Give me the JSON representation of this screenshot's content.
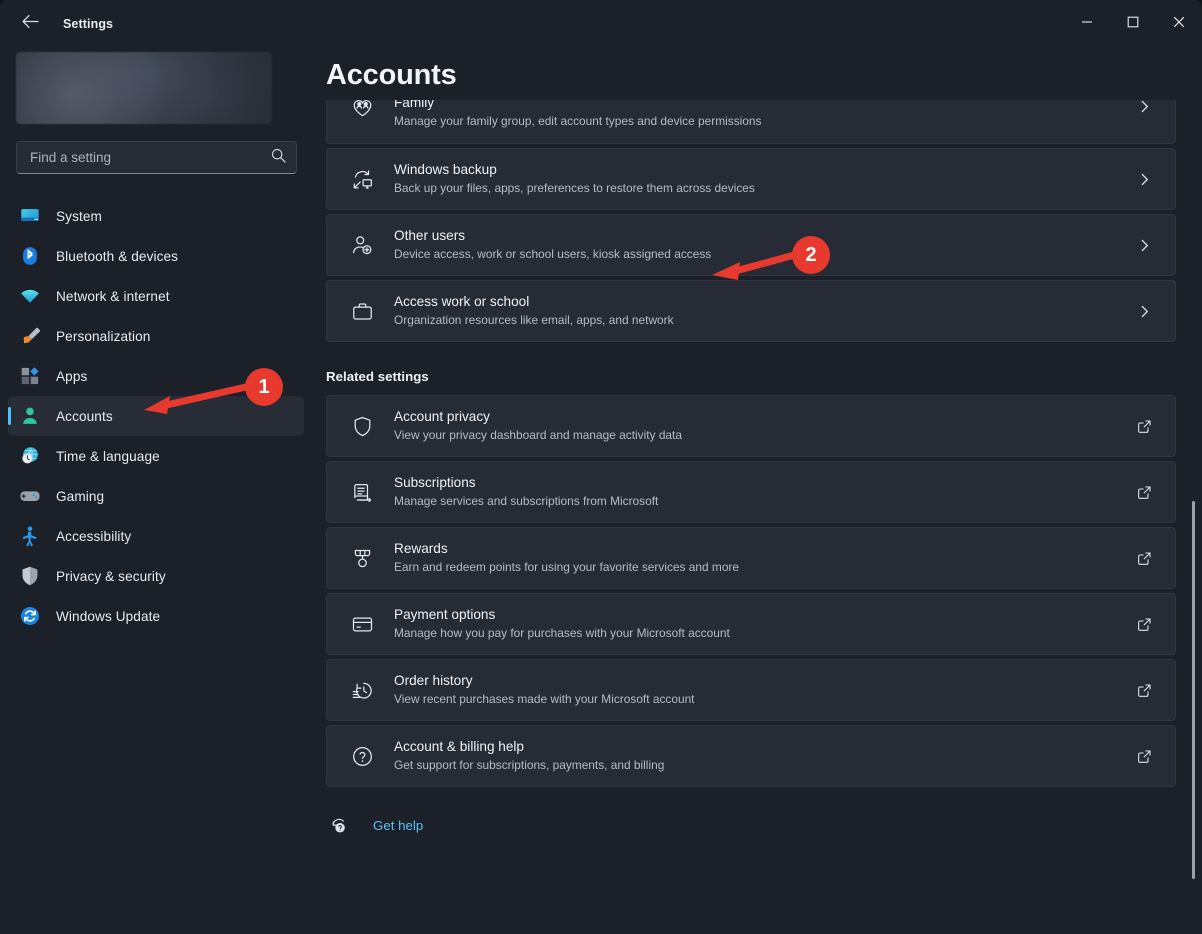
{
  "window": {
    "app_title": "Settings",
    "back_icon": "back-arrow-icon",
    "minimize_label": "Minimize",
    "maximize_label": "Maximize",
    "close_label": "Close"
  },
  "sidebar": {
    "profile": {
      "blurred": true,
      "name": ""
    },
    "search": {
      "placeholder": "Find a setting",
      "value": "",
      "icon": "search-icon"
    },
    "items": [
      {
        "label": "System",
        "icon": "monitor-icon",
        "active": false
      },
      {
        "label": "Bluetooth & devices",
        "icon": "bluetooth-icon",
        "active": false
      },
      {
        "label": "Network & internet",
        "icon": "wifi-icon",
        "active": false
      },
      {
        "label": "Personalization",
        "icon": "paintbrush-icon",
        "active": false
      },
      {
        "label": "Apps",
        "icon": "apps-grid-icon",
        "active": false
      },
      {
        "label": "Accounts",
        "icon": "person-icon",
        "active": true
      },
      {
        "label": "Time & language",
        "icon": "globe-clock-icon",
        "active": false
      },
      {
        "label": "Gaming",
        "icon": "gamepad-icon",
        "active": false
      },
      {
        "label": "Accessibility",
        "icon": "accessibility-icon",
        "active": false
      },
      {
        "label": "Privacy & security",
        "icon": "shield-icon",
        "active": false
      },
      {
        "label": "Windows Update",
        "icon": "update-icon",
        "active": false
      }
    ]
  },
  "main": {
    "page_title": "Accounts",
    "cards": [
      {
        "title": "Family",
        "subtitle": "Manage your family group, edit account types and device permissions",
        "icon": "family-heart-icon",
        "end_icon": "chevron-right-icon",
        "clipped": true
      },
      {
        "title": "Windows backup",
        "subtitle": "Back up your files, apps, preferences to restore them across devices",
        "icon": "backup-icon",
        "end_icon": "chevron-right-icon",
        "clipped": false
      },
      {
        "title": "Other users",
        "subtitle": "Device access, work or school users, kiosk assigned access",
        "icon": "add-user-icon",
        "end_icon": "chevron-right-icon",
        "clipped": false
      },
      {
        "title": "Access work or school",
        "subtitle": "Organization resources like email, apps, and network",
        "icon": "briefcase-icon",
        "end_icon": "chevron-right-icon",
        "clipped": false
      }
    ],
    "related_settings_heading": "Related settings",
    "related_cards": [
      {
        "title": "Account privacy",
        "subtitle": "View your privacy dashboard and manage activity data",
        "icon": "shield-outline-icon",
        "end_icon": "external-link-icon"
      },
      {
        "title": "Subscriptions",
        "subtitle": "Manage services and subscriptions from Microsoft",
        "icon": "subscription-doc-icon",
        "end_icon": "external-link-icon"
      },
      {
        "title": "Rewards",
        "subtitle": "Earn and redeem points for using your favorite services and more",
        "icon": "medal-icon",
        "end_icon": "external-link-icon"
      },
      {
        "title": "Payment options",
        "subtitle": "Manage how you pay for purchases with your Microsoft account",
        "icon": "credit-card-icon",
        "end_icon": "external-link-icon"
      },
      {
        "title": "Order history",
        "subtitle": "View recent purchases made with your Microsoft account",
        "icon": "order-history-icon",
        "end_icon": "external-link-icon"
      },
      {
        "title": "Account & billing help",
        "subtitle": "Get support for subscriptions, payments, and billing",
        "icon": "question-circle-icon",
        "end_icon": "external-link-icon"
      }
    ],
    "get_help": {
      "label": "Get help",
      "icon": "get-help-icon"
    }
  },
  "annotations": [
    {
      "number": "1",
      "color": "#e8392e",
      "points_at": "Accounts"
    },
    {
      "number": "2",
      "color": "#e8392e",
      "points_at": "Other users"
    }
  ]
}
